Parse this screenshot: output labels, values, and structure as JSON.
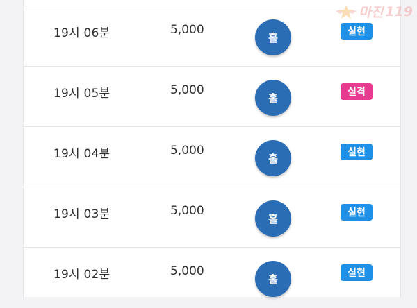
{
  "watermark": {
    "brand": "마진",
    "suffix": "119"
  },
  "colors": {
    "button_blue": "#2b6db5",
    "badge_hit": "#1e90e8",
    "badge_miss": "#e83a8f"
  },
  "rows": [
    {
      "time": "19시 06분",
      "amount": "5,000",
      "pick": "홀",
      "result": "실현"
    },
    {
      "time": "19시 05분",
      "amount": "5,000",
      "pick": "홀",
      "result": "실격"
    },
    {
      "time": "19시 04분",
      "amount": "5,000",
      "pick": "홀",
      "result": "실현"
    },
    {
      "time": "19시 03분",
      "amount": "5,000",
      "pick": "홀",
      "result": "실현"
    },
    {
      "time": "19시 02분",
      "amount": "5,000",
      "pick": "홀",
      "result": "실현"
    }
  ]
}
